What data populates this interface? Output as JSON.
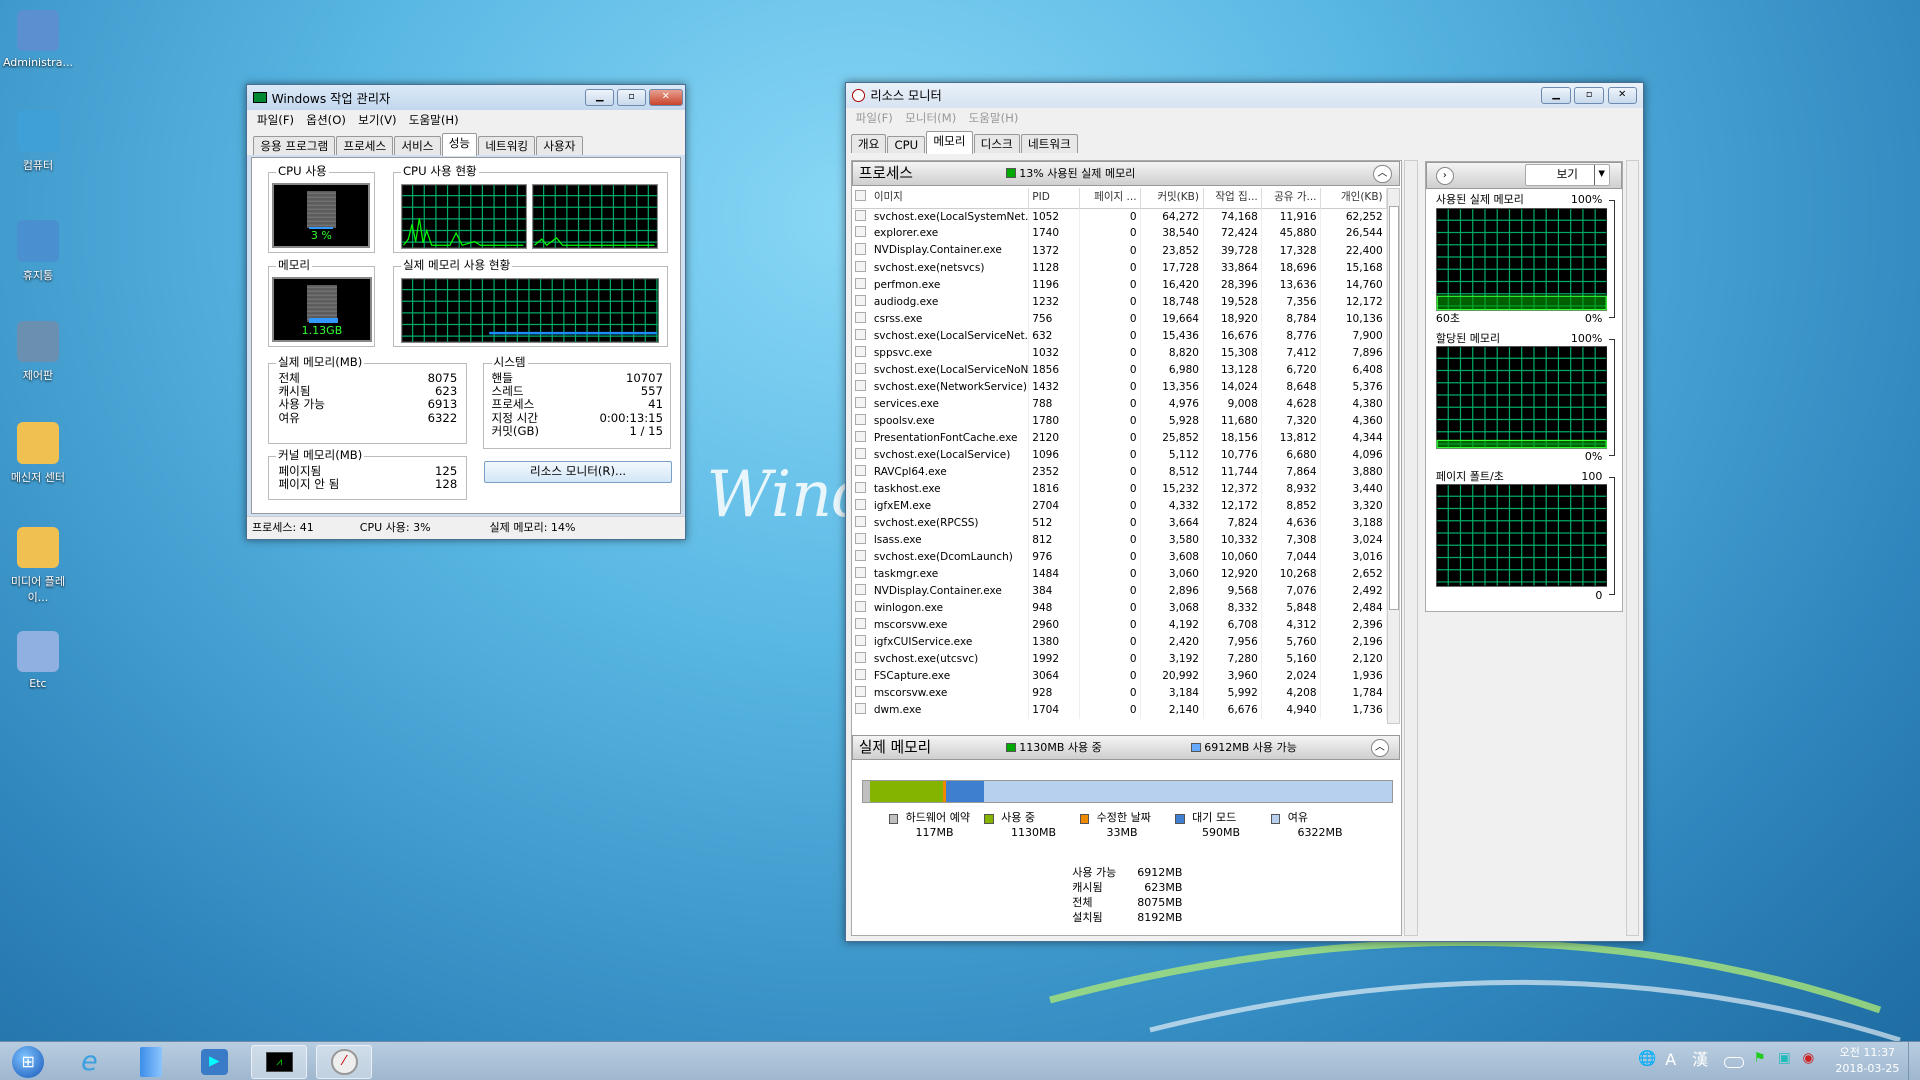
{
  "desktop": {
    "icons": [
      {
        "label": "Administra...",
        "icon": "user-folder-icon"
      },
      {
        "label": "컴퓨터",
        "icon": "computer-icon"
      },
      {
        "label": "휴지통",
        "icon": "recycle-bin-icon"
      },
      {
        "label": "제어판",
        "icon": "control-panel-icon"
      },
      {
        "label": "메신저 센터",
        "icon": "messenger-folder-icon"
      },
      {
        "label": "미디어 플레이...",
        "icon": "media-player-folder-icon"
      },
      {
        "label": "Etc",
        "icon": "folder-icon"
      }
    ],
    "wallpaper_logo": "Windows"
  },
  "taskmgr": {
    "title": "Windows 작업 관리자",
    "menu": [
      "파일(F)",
      "옵션(O)",
      "보기(V)",
      "도움말(H)"
    ],
    "tabs": [
      "응용 프로그램",
      "프로세스",
      "서비스",
      "성능",
      "네트워킹",
      "사용자"
    ],
    "active_tab": "성능",
    "cpu_group": "CPU 사용",
    "cpu_value": "3 %",
    "cpu_percent": 3,
    "cpu_history_group": "CPU 사용 현황",
    "mem_group": "메모리",
    "mem_value": "1.13GB",
    "mem_history_group": "실제 메모리 사용 현황",
    "physical": {
      "label": "실제 메모리(MB)",
      "rows": [
        [
          "전체",
          "8075"
        ],
        [
          "캐시됨",
          "623"
        ],
        [
          "사용 가능",
          "6913"
        ],
        [
          "여유",
          "6322"
        ]
      ]
    },
    "system": {
      "label": "시스템",
      "rows": [
        [
          "핸들",
          "10707"
        ],
        [
          "스레드",
          "557"
        ],
        [
          "프로세스",
          "41"
        ],
        [
          "지정 시간",
          "0:00:13:15"
        ],
        [
          "커밋(GB)",
          "1 / 15"
        ]
      ]
    },
    "kernel": {
      "label": "커널 메모리(MB)",
      "rows": [
        [
          "페이지됨",
          "125"
        ],
        [
          "페이지 안 됨",
          "128"
        ]
      ]
    },
    "resmon_button": "리소스 모니터(R)...",
    "status": {
      "processes": "프로세스: 41",
      "cpu": "CPU 사용: 3%",
      "memory": "실제 메모리: 14%"
    }
  },
  "resmon": {
    "title": "리소스 모니터",
    "menu": [
      "파일(F)",
      "모니터(M)",
      "도움말(H)"
    ],
    "tabs": [
      "개요",
      "CPU",
      "메모리",
      "디스크",
      "네트워크"
    ],
    "active_tab": "메모리",
    "process_section": {
      "title": "프로세스",
      "indicator": "13% 사용된 실제 메모리",
      "columns": [
        "이미지",
        "PID",
        "페이지 ...",
        "커밋(KB)",
        "작업 집...",
        "공유 가...",
        "개인(KB)"
      ],
      "rows": [
        [
          "svchost.exe(LocalSystemNet...",
          "1052",
          "0",
          "64,272",
          "74,168",
          "11,916",
          "62,252"
        ],
        [
          "explorer.exe",
          "1740",
          "0",
          "38,540",
          "72,424",
          "45,880",
          "26,544"
        ],
        [
          "NVDisplay.Container.exe",
          "1372",
          "0",
          "23,852",
          "39,728",
          "17,328",
          "22,400"
        ],
        [
          "svchost.exe(netsvcs)",
          "1128",
          "0",
          "17,728",
          "33,864",
          "18,696",
          "15,168"
        ],
        [
          "perfmon.exe",
          "1196",
          "0",
          "16,420",
          "28,396",
          "13,636",
          "14,760"
        ],
        [
          "audiodg.exe",
          "1232",
          "0",
          "18,748",
          "19,528",
          "7,356",
          "12,172"
        ],
        [
          "csrss.exe",
          "756",
          "0",
          "19,664",
          "18,920",
          "8,784",
          "10,136"
        ],
        [
          "svchost.exe(LocalServiceNet...",
          "632",
          "0",
          "15,436",
          "16,676",
          "8,776",
          "7,900"
        ],
        [
          "sppsvc.exe",
          "1032",
          "0",
          "8,820",
          "15,308",
          "7,412",
          "7,896"
        ],
        [
          "svchost.exe(LocalServiceNoN...",
          "1856",
          "0",
          "6,980",
          "13,128",
          "6,720",
          "6,408"
        ],
        [
          "svchost.exe(NetworkService)",
          "1432",
          "0",
          "13,356",
          "14,024",
          "8,648",
          "5,376"
        ],
        [
          "services.exe",
          "788",
          "0",
          "4,976",
          "9,008",
          "4,628",
          "4,380"
        ],
        [
          "spoolsv.exe",
          "1780",
          "0",
          "5,928",
          "11,680",
          "7,320",
          "4,360"
        ],
        [
          "PresentationFontCache.exe",
          "2120",
          "0",
          "25,852",
          "18,156",
          "13,812",
          "4,344"
        ],
        [
          "svchost.exe(LocalService)",
          "1096",
          "0",
          "5,112",
          "10,776",
          "6,680",
          "4,096"
        ],
        [
          "RAVCpl64.exe",
          "2352",
          "0",
          "8,512",
          "11,744",
          "7,864",
          "3,880"
        ],
        [
          "taskhost.exe",
          "1816",
          "0",
          "15,232",
          "12,372",
          "8,932",
          "3,440"
        ],
        [
          "igfxEM.exe",
          "2704",
          "0",
          "4,332",
          "12,172",
          "8,852",
          "3,320"
        ],
        [
          "svchost.exe(RPCSS)",
          "512",
          "0",
          "3,664",
          "7,824",
          "4,636",
          "3,188"
        ],
        [
          "lsass.exe",
          "812",
          "0",
          "3,580",
          "10,332",
          "7,308",
          "3,024"
        ],
        [
          "svchost.exe(DcomLaunch)",
          "976",
          "0",
          "3,608",
          "10,060",
          "7,044",
          "3,016"
        ],
        [
          "taskmgr.exe",
          "1484",
          "0",
          "3,060",
          "12,920",
          "10,268",
          "2,652"
        ],
        [
          "NVDisplay.Container.exe",
          "384",
          "0",
          "2,896",
          "9,568",
          "7,076",
          "2,492"
        ],
        [
          "winlogon.exe",
          "948",
          "0",
          "3,068",
          "8,332",
          "5,848",
          "2,484"
        ],
        [
          "mscorsvw.exe",
          "2960",
          "0",
          "4,192",
          "6,708",
          "4,312",
          "2,396"
        ],
        [
          "igfxCUIService.exe",
          "1380",
          "0",
          "2,420",
          "7,956",
          "5,760",
          "2,196"
        ],
        [
          "svchost.exe(utcsvc)",
          "1992",
          "0",
          "3,192",
          "7,280",
          "5,160",
          "2,120"
        ],
        [
          "FSCapture.exe",
          "3064",
          "0",
          "20,992",
          "3,960",
          "2,024",
          "1,936"
        ],
        [
          "mscorsvw.exe",
          "928",
          "0",
          "3,184",
          "5,992",
          "4,208",
          "1,784"
        ],
        [
          "dwm.exe",
          "1704",
          "0",
          "2,140",
          "6,676",
          "4,940",
          "1,736"
        ]
      ]
    },
    "memory_section": {
      "title": "실제 메모리",
      "in_use": "1130MB 사용 중",
      "available": "6912MB 사용 가능",
      "bar": [
        {
          "label": "하드웨어 예약",
          "value": "117MB",
          "mb": 117,
          "color": "#c0c0c0"
        },
        {
          "label": "사용 중",
          "value": "1130MB",
          "mb": 1130,
          "color": "#84b300"
        },
        {
          "label": "수정한 날짜",
          "value": "33MB",
          "mb": 33,
          "color": "#ef8a00"
        },
        {
          "label": "대기 모드",
          "value": "590MB",
          "mb": 590,
          "color": "#3f7fcf"
        },
        {
          "label": "여유",
          "value": "6322MB",
          "mb": 6322,
          "color": "#b7d0ee"
        }
      ],
      "stats": [
        [
          "사용 가능",
          "6912MB"
        ],
        [
          "캐시됨",
          "623MB"
        ],
        [
          "전체",
          "8075MB"
        ],
        [
          "설치됨",
          "8192MB"
        ]
      ]
    },
    "side": {
      "view_label": "보기",
      "graphs": [
        {
          "title": "사용된 실제 메모리",
          "max": "100%",
          "min": "0%",
          "time": "60초",
          "level": 13
        },
        {
          "title": "할당된 메모리",
          "max": "100%",
          "min": "0%",
          "level": 7
        },
        {
          "title": "페이지 폴트/초",
          "max": "100",
          "min": "0",
          "level": 0
        }
      ]
    }
  },
  "taskbar": {
    "tray": [
      "A",
      "漢"
    ],
    "time": "오전 11:37",
    "date": "2018-03-25"
  }
}
